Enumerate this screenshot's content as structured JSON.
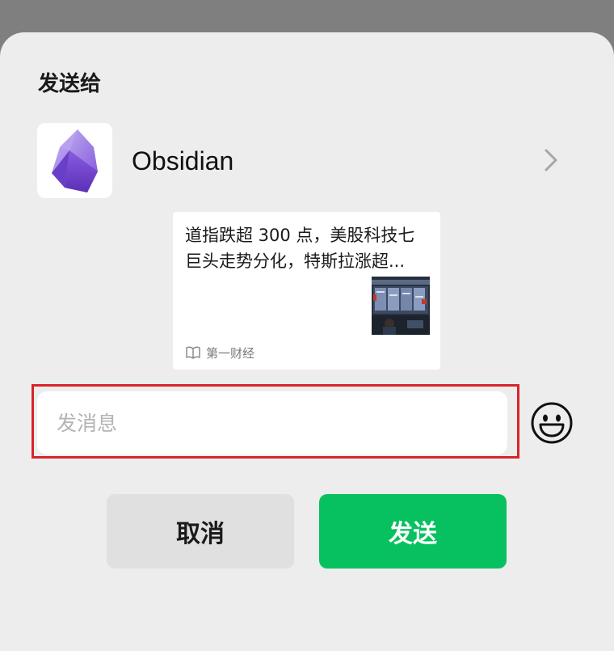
{
  "dialog": {
    "title": "发送给"
  },
  "recipient": {
    "name": "Obsidian",
    "avatar_icon": "obsidian-logo-icon"
  },
  "article_card": {
    "title_line1": "道指跌超 300 点，美股科技七",
    "title_line2": "巨头走势分化，特斯拉涨超...",
    "source": "第一财经",
    "source_icon": "open-book-icon",
    "thumbnail_icon": "stock-exchange-photo"
  },
  "message": {
    "placeholder": "发消息",
    "value": "",
    "emoji_icon": "smiley-face-icon"
  },
  "buttons": {
    "cancel_label": "取消",
    "send_label": "发送"
  },
  "colors": {
    "send_button": "#07c160",
    "highlight_border": "#d9232a",
    "sheet_background": "#ededed",
    "overlay": "#7f7f7f"
  }
}
